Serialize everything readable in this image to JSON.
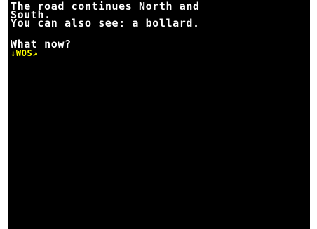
{
  "game": {
    "lines": [
      "The road continues North and",
      "South.",
      "You can also see: a bollard.",
      "What now?"
    ],
    "input_prompt": "↓WOS",
    "cursor": "↗"
  },
  "colors": {
    "background": "#000000",
    "text": "#ffffff",
    "input": "#ffff00",
    "border": "#ffffff"
  }
}
